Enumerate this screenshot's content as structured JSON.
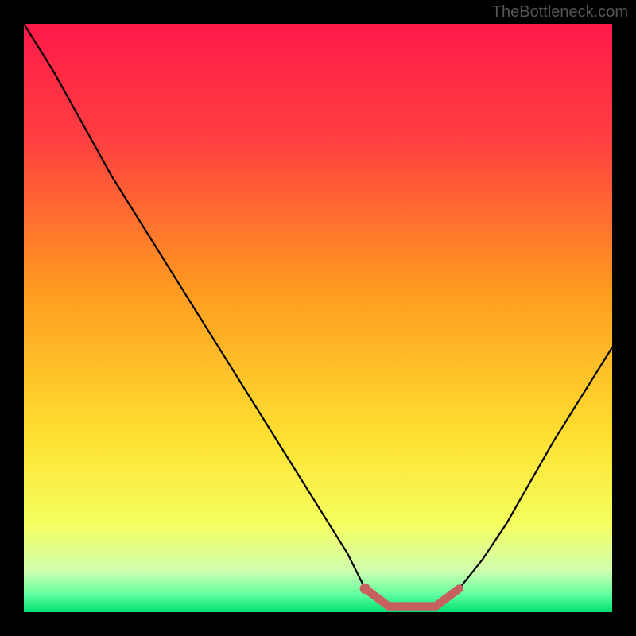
{
  "watermark": "TheBottleneck.com",
  "chart_data": {
    "type": "line",
    "title": "",
    "xlabel": "",
    "ylabel": "",
    "xlim": [
      0,
      100
    ],
    "ylim": [
      0,
      100
    ],
    "series": [
      {
        "name": "bottleneck-curve",
        "x": [
          0,
          5,
          10,
          15,
          20,
          25,
          30,
          35,
          40,
          45,
          50,
          55,
          58,
          62,
          66,
          70,
          74,
          78,
          82,
          86,
          90,
          95,
          100
        ],
        "values": [
          100,
          92,
          83,
          74,
          66,
          58,
          50,
          42,
          34,
          26,
          18,
          10,
          4,
          1,
          1,
          1,
          4,
          9,
          15,
          22,
          29,
          37,
          45
        ]
      }
    ],
    "highlight": {
      "name": "optimal-range",
      "x_start": 58,
      "x_end": 74,
      "color": "#c96060"
    },
    "gradient_stops": [
      {
        "pos": 0,
        "color": "#ff1a4a"
      },
      {
        "pos": 20,
        "color": "#ff4040"
      },
      {
        "pos": 45,
        "color": "#ff9a20"
      },
      {
        "pos": 70,
        "color": "#ffe030"
      },
      {
        "pos": 85,
        "color": "#f5ff60"
      },
      {
        "pos": 93,
        "color": "#d0ffb0"
      },
      {
        "pos": 97,
        "color": "#60ffa0"
      },
      {
        "pos": 100,
        "color": "#00e070"
      }
    ]
  }
}
